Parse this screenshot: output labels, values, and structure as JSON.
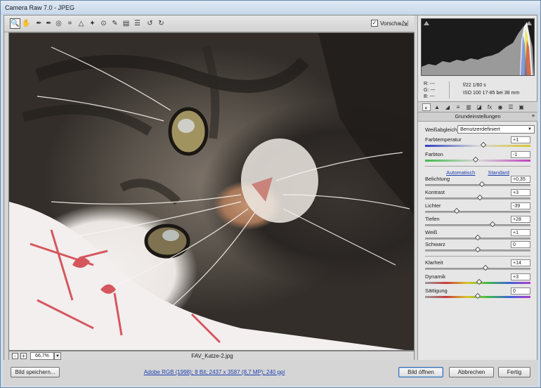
{
  "window": {
    "title": "Camera Raw 7.0 - JPEG"
  },
  "toolbar": {
    "tools": [
      {
        "name": "zoom-tool",
        "glyph": "🔍"
      },
      {
        "name": "hand-tool",
        "glyph": "✋"
      },
      {
        "name": "white-balance-tool",
        "glyph": "✒"
      },
      {
        "name": "color-sampler-tool",
        "glyph": "✒"
      },
      {
        "name": "targeted-adjustment-tool",
        "glyph": "◎"
      },
      {
        "name": "crop-tool",
        "glyph": "⌗"
      },
      {
        "name": "straighten-tool",
        "glyph": "△"
      },
      {
        "name": "spot-removal-tool",
        "glyph": "✦"
      },
      {
        "name": "red-eye-tool",
        "glyph": "⊙"
      },
      {
        "name": "adjustment-brush-tool",
        "glyph": "✎"
      },
      {
        "name": "graduated-filter-tool",
        "glyph": "▤"
      },
      {
        "name": "preferences-tool",
        "glyph": "☰"
      },
      {
        "name": "rotate-left-tool",
        "glyph": "↺"
      },
      {
        "name": "rotate-right-tool",
        "glyph": "↻"
      }
    ],
    "preview_label": "Vorschau",
    "preview_checked": "✓",
    "fullscreen_glyph": "⇲"
  },
  "image": {
    "filename": "FAV_Katze-2.jpg",
    "zoom_minus": "-",
    "zoom_plus": "+",
    "zoom_value": "66,7%",
    "zoom_arrow": "▼"
  },
  "readout": {
    "r": "R:   ---",
    "g": "G:   ---",
    "b": "B:   ---",
    "aperture_shutter": "f/22    1/60 s",
    "iso_lens": "ISO 100    17-85 bei 38 mm"
  },
  "panel": {
    "tabs": [
      "◐",
      "▲",
      "◢",
      "≡",
      "▥",
      "◪",
      "fx",
      "◉",
      "☰",
      "▣"
    ],
    "header": "Grundeinstellungen",
    "header_menu": "≡",
    "wb_label": "Weißabgleich:",
    "wb_value": "Benutzerdefiniert",
    "wb_arrow": "▼",
    "auto_label": "Automatisch",
    "standard_label": "Standard"
  },
  "sliders": [
    {
      "key": "temp",
      "label": "Farbtemperatur",
      "value": "+1",
      "level": 0.55
    },
    {
      "key": "tint",
      "label": "Farbton",
      "value": "-1",
      "level": 0.48
    },
    {
      "key": "exposure",
      "label": "Belichtung",
      "value": "+0,35",
      "level": 0.54
    },
    {
      "key": "contrast",
      "label": "Kontrast",
      "value": "+3",
      "level": 0.52
    },
    {
      "key": "highlights",
      "label": "Lichter",
      "value": "-39",
      "level": 0.3
    },
    {
      "key": "shadows",
      "label": "Tiefen",
      "value": "+28",
      "level": 0.64
    },
    {
      "key": "whites",
      "label": "Weiß",
      "value": "+1",
      "level": 0.5
    },
    {
      "key": "blacks",
      "label": "Schwarz",
      "value": "0",
      "level": 0.5
    },
    {
      "key": "clarity",
      "label": "Klarheit",
      "value": "+14",
      "level": 0.57
    },
    {
      "key": "vibrance",
      "label": "Dynamik",
      "value": "+3",
      "level": 0.51
    },
    {
      "key": "saturation",
      "label": "Sättigung",
      "value": "0",
      "level": 0.5
    }
  ],
  "bottom": {
    "save_label": "Bild speichern...",
    "workflow_label": "Adobe RGB (1998); 8 Bit; 2437 x 3587 (8,7 MP); 240 ppi",
    "open_label": "Bild öffnen",
    "cancel_label": "Abbrechen",
    "done_label": "Fertig"
  }
}
